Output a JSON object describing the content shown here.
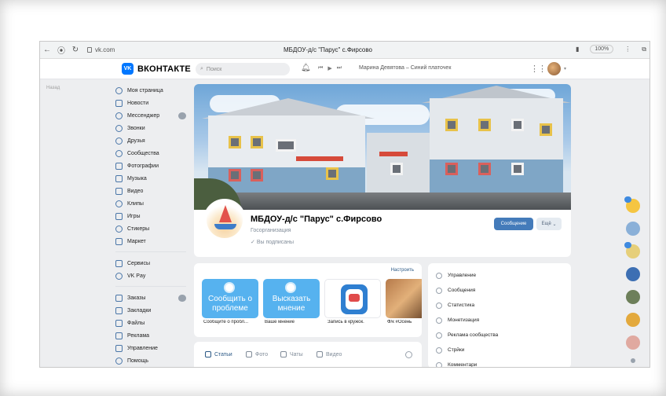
{
  "browser": {
    "url": "vk.com",
    "title": "МБДОУ-д/с \"Парус\" с.Фирсово",
    "zoom": "100%"
  },
  "header": {
    "logo_text": "ВКОНТАКТЕ",
    "search_placeholder": "Поиск",
    "now_playing": "Марина Девятова – Синий платочек"
  },
  "left_note": "Назад",
  "sidebar": {
    "items": [
      {
        "label": "Моя страница",
        "icon": "user-icon"
      },
      {
        "label": "Новости",
        "icon": "news-icon"
      },
      {
        "label": "Мессенджер",
        "icon": "chat-icon",
        "badge": true
      },
      {
        "label": "Звонки",
        "icon": "phone-icon"
      },
      {
        "label": "Друзья",
        "icon": "friends-icon"
      },
      {
        "label": "Сообщества",
        "icon": "community-icon"
      },
      {
        "label": "Фотографии",
        "icon": "photo-icon"
      },
      {
        "label": "Музыка",
        "icon": "music-icon"
      },
      {
        "label": "Видео",
        "icon": "video-icon"
      },
      {
        "label": "Клипы",
        "icon": "clips-icon"
      },
      {
        "label": "Игры",
        "icon": "games-icon"
      },
      {
        "label": "Стикеры",
        "icon": "sticker-icon"
      },
      {
        "label": "Маркет",
        "icon": "market-icon"
      }
    ],
    "items2": [
      {
        "label": "Сервисы",
        "icon": "services-icon"
      },
      {
        "label": "VK Pay",
        "icon": "vkpay-icon"
      }
    ],
    "items3": [
      {
        "label": "Заказы",
        "icon": "orders-icon",
        "badge": true
      },
      {
        "label": "Закладки",
        "icon": "bookmark-icon"
      },
      {
        "label": "Файлы",
        "icon": "files-icon"
      },
      {
        "label": "Реклама",
        "icon": "ads-icon"
      },
      {
        "label": "Управление",
        "icon": "manage-icon"
      },
      {
        "label": "Помощь",
        "icon": "help-icon"
      }
    ]
  },
  "group": {
    "name": "МБДОУ-д/с \"Парус\" с.Фирсово",
    "type": "Госорганизация",
    "subscribed": "Вы подписаны",
    "message_button": "Сообщение",
    "more_button": "Ещё"
  },
  "apps": {
    "config_label": "Настроить",
    "tiles": [
      {
        "text": "Сообщить о проблеме",
        "caption": "Сообщите о пробл..."
      },
      {
        "text": "Высказать мнение",
        "caption": "Ваше мнение"
      },
      {
        "text": "",
        "caption": "Запись в кружок."
      },
      {
        "text": "",
        "caption": "Ф/к #Осень"
      }
    ]
  },
  "tabs": [
    {
      "label": "Статьи",
      "active": true
    },
    {
      "label": "Фото",
      "active": false
    },
    {
      "label": "Чаты",
      "active": false
    },
    {
      "label": "Видео",
      "active": false
    }
  ],
  "right_menu": [
    "Управление",
    "Сообщения",
    "Статистика",
    "Монетизация",
    "Реклама сообщества",
    "Стрйки",
    "Комментари"
  ],
  "colors": {
    "vk_blue": "#0077ff",
    "button_blue": "#447bba",
    "link": "#2a5885",
    "bg": "#edeef0"
  }
}
